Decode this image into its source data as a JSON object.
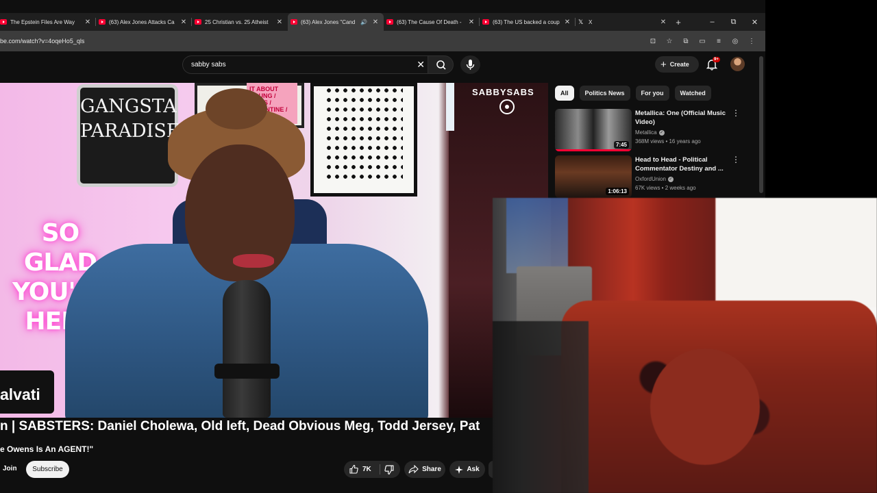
{
  "browser": {
    "tabs": [
      {
        "title": "The Epstein Files Are Way",
        "active": false,
        "icon": "youtube-icon"
      },
      {
        "title": "(63) Alex Jones Attacks Ca",
        "active": false,
        "icon": "youtube-icon"
      },
      {
        "title": "25 Christian vs. 25 Atheist",
        "active": false,
        "icon": "youtube-icon"
      },
      {
        "title": "(63) Alex Jones \"Cand",
        "active": true,
        "icon": "youtube-icon",
        "audio": true
      },
      {
        "title": "(63) The Cause Of Death -",
        "active": false,
        "icon": "youtube-icon"
      },
      {
        "title": "(63) The US backed a coup",
        "active": false,
        "icon": "youtube-icon"
      },
      {
        "title": "X",
        "active": false,
        "icon": "x-logo-icon"
      }
    ],
    "new_tab": "+",
    "window_controls": {
      "minimize": "–",
      "maximize": "⧉",
      "close": "✕"
    },
    "url": "be.com/watch?v=4oqeHo5_qls"
  },
  "youtube": {
    "search": {
      "value": "sabby sabs",
      "clear": "✕"
    },
    "create_label": "Create",
    "notifications_badge": "9+",
    "video": {
      "channel_overlay": "SABBYSABS",
      "poster_text": "GANGSTA PARADISE",
      "poster_small": "IT ABOUT COUNG / DAVIS / VALENTINE / NKHOLM",
      "neon_text": "SO GLAD YOU'RE HERE",
      "lower_third": "alvati"
    },
    "title": "n | SABSTERS: Daniel Cholewa, Old left, Dead Obvious Meg, Todd Jersey, Pat",
    "subtitle": "e Owens Is An AGENT!\"",
    "actions": {
      "join": "Join",
      "subscribe": "Subscribe",
      "likes": "7K",
      "share": "Share",
      "ask": "Ask"
    },
    "chips": [
      {
        "label": "All",
        "active": true
      },
      {
        "label": "Politics News",
        "active": false
      },
      {
        "label": "For you",
        "active": false
      },
      {
        "label": "Watched",
        "active": false
      }
    ],
    "recommendations": [
      {
        "title": "Metallica: One (Official Music Video)",
        "channel": "Metallica",
        "verified": true,
        "meta": "368M views • 16 years ago",
        "duration": "7:45",
        "progress": 1.0
      },
      {
        "title": "Head to Head - Political Commentator Destiny and ...",
        "channel": "OxfordUnion",
        "verified": true,
        "meta": "67K views • 2 weeks ago",
        "duration": "1:06:13",
        "progress": 0.0
      }
    ]
  },
  "colors": {
    "accent": "#ff0033",
    "background": "#0f0f0f",
    "chip_bg": "#272727"
  }
}
